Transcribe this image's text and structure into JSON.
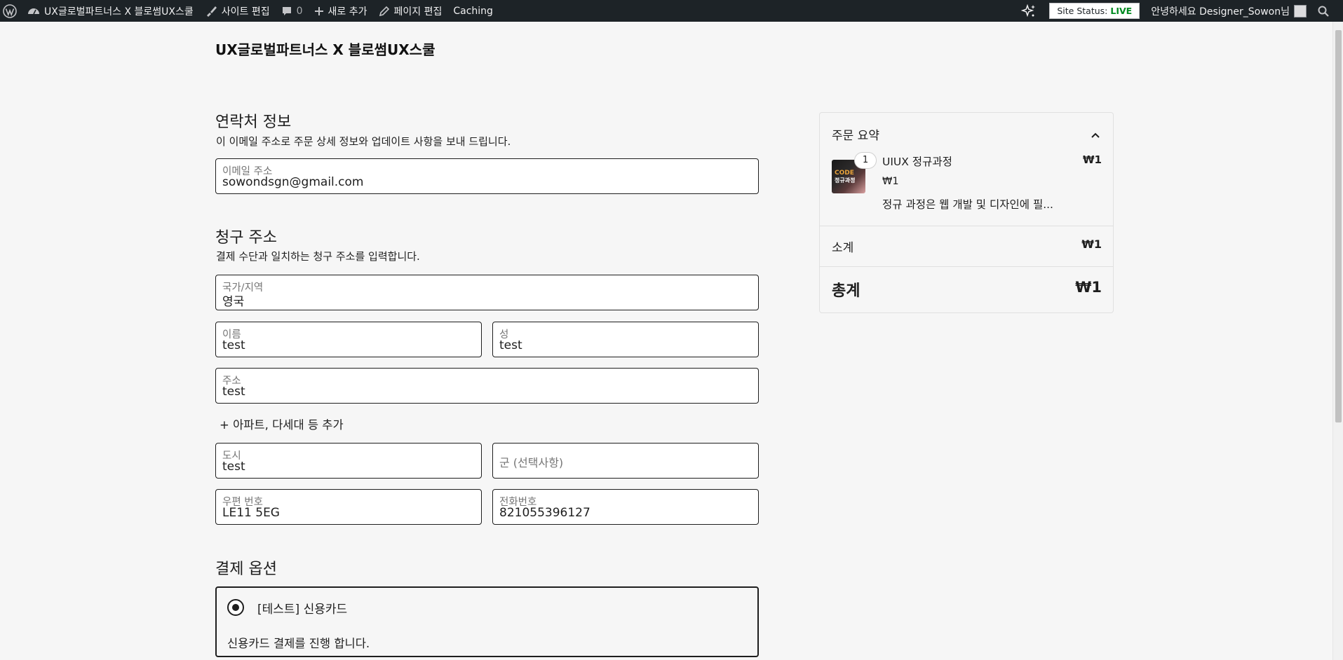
{
  "adminbar": {
    "site_name": "UX글로벌파트너스 X 블로썸UX스쿨",
    "edit_site": "사이트 편집",
    "comments_count": "0",
    "new_item": "새로 추가",
    "edit_page": "페이지 편집",
    "caching": "Caching",
    "site_status_prefix": "Site Status:",
    "site_status_value": "LIVE",
    "greeting": "안녕하세요 Designer_Sowon님"
  },
  "header": {
    "site_title": "UX글로벌파트너스 X 블로썸UX스쿨"
  },
  "contact": {
    "heading": "연락처 정보",
    "description": "이 이메일 주소로 주문 상세 정보와 업데이트 사항을 보내 드립니다.",
    "email_label": "이메일 주소",
    "email_value": "sowondsgn@gmail.com"
  },
  "billing": {
    "heading": "청구 주소",
    "description": "결제 수단과 일치하는 청구 주소를 입력합니다.",
    "country_label": "국가/지역",
    "country_value": "영국",
    "first_name_label": "이름",
    "first_name_value": "test",
    "last_name_label": "성",
    "last_name_value": "test",
    "address_label": "주소",
    "address_value": "test",
    "add_apartment": "+ 아파트, 다세대 등 추가",
    "city_label": "도시",
    "city_value": "test",
    "county_placeholder": "군 (선택사항)",
    "postcode_label": "우편 번호",
    "postcode_value": "LE11 5EG",
    "phone_label": "전화번호",
    "phone_value": "821055396127"
  },
  "payment": {
    "heading": "결제 옵션",
    "option_label": "[테스트] 신용카드",
    "option_description": "신용카드 결제를 진행 합니다."
  },
  "summary": {
    "title": "주문 요약",
    "product": {
      "quantity": "1",
      "name": "UIUX 정규과정",
      "line_total": "₩1",
      "unit_price": "₩1",
      "description": "정규 과정은 웹 개발 및 디자인에 필...",
      "image_text_1": "CODE",
      "image_text_2": "정규과정"
    },
    "subtotal_label": "소계",
    "subtotal_value": "₩1",
    "total_label": "총계",
    "total_value": "₩1"
  },
  "colors": {
    "adminbar_bg": "#1d2327",
    "page_bg": "#f6f6f6",
    "status_live": "#008a20"
  }
}
